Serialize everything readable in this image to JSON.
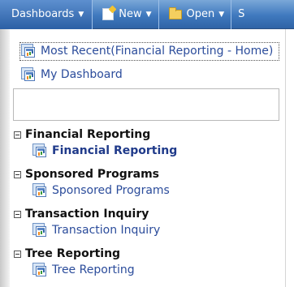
{
  "toolbar": {
    "dashboards_label": "Dashboards",
    "new_label": "New",
    "open_label": "Open",
    "more_label": "S"
  },
  "menu": {
    "most_recent_label": "Most Recent(Financial Reporting - Home)",
    "my_dashboard_label": "My Dashboard",
    "categories": [
      {
        "title": "Financial Reporting",
        "item": "Financial Reporting"
      },
      {
        "title": "Sponsored Programs",
        "item": "Sponsored Programs"
      },
      {
        "title": "Transaction Inquiry",
        "item": "Transaction Inquiry"
      },
      {
        "title": "Tree Reporting",
        "item": "Tree Reporting"
      }
    ]
  },
  "colors": {
    "toolbar_blue": "#3f79be",
    "link_blue": "#2b4c9b"
  }
}
